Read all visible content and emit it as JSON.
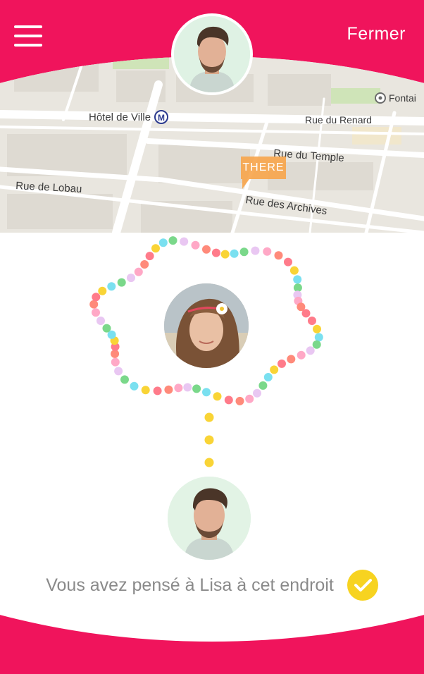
{
  "header": {
    "menu_icon": "hamburger-menu-icon",
    "close_label": "Fermer",
    "background_color": "#f0145c"
  },
  "map": {
    "labels": {
      "hotel_de_ville": "Hôtel de Ville",
      "metro": "M",
      "rue_du_renard": "Rue du Renard",
      "rue_du_temple": "Rue du Temple",
      "rue_de_lobau": "Rue de Lobau",
      "rue_des_archives": "Rue des Archives",
      "fontaine": "Fontai"
    },
    "marker_label": "THERE",
    "marker_color": "#f7a44a"
  },
  "message": {
    "text": "Vous avez pensé à Lisa à cet endroit",
    "icon": "check-circle-icon",
    "icon_color": "#f7d320"
  },
  "dot_colors": [
    "#ff7b8a",
    "#f9d436",
    "#7ae0f0",
    "#7ad88a",
    "#e9c7f2",
    "#ffa8c6",
    "#ff8a7a"
  ]
}
